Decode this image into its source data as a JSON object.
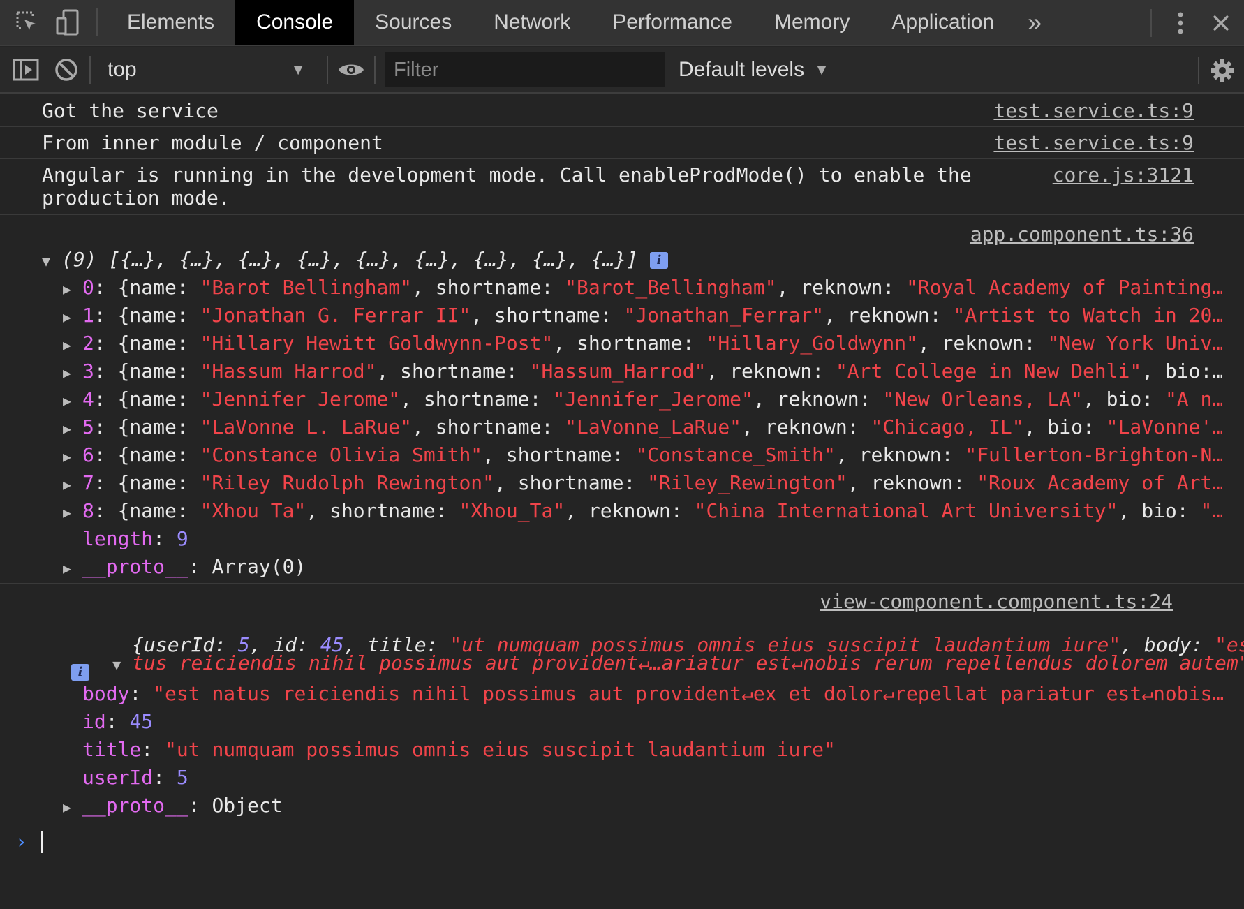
{
  "tabs": [
    {
      "label": "Elements"
    },
    {
      "label": "Console"
    },
    {
      "label": "Sources"
    },
    {
      "label": "Network"
    },
    {
      "label": "Performance"
    },
    {
      "label": "Memory"
    },
    {
      "label": "Application"
    }
  ],
  "tabbar": {
    "more": "»"
  },
  "toolbar": {
    "context": "top",
    "filter_placeholder": "Filter",
    "levels": "Default levels"
  },
  "messages": [
    {
      "text": "Got the service",
      "source": "test.service.ts:9"
    },
    {
      "text": "From inner module / component",
      "source": "test.service.ts:9"
    },
    {
      "text_line1": "Angular is running in the development mode. Call enableProdMode() to enable the",
      "text_line2": "production mode.",
      "source": "core.js:3121"
    }
  ],
  "array_log": {
    "source": "app.component.ts:36",
    "summary": "(9) [{…}, {…}, {…}, {…}, {…}, {…}, {…}, {…}, {…}]",
    "items": [
      {
        "index": "0",
        "name": "\"Barot Bellingham\"",
        "shortname": "\"Barot_Bellingham\"",
        "tail_key": "reknown",
        "tail_val": "\"Royal Academy of Painting…"
      },
      {
        "index": "1",
        "name": "\"Jonathan G. Ferrar II\"",
        "shortname": "\"Jonathan_Ferrar\"",
        "tail_key": "reknown",
        "tail_val": "\"Artist to Watch in 20…"
      },
      {
        "index": "2",
        "name": "\"Hillary Hewitt Goldwynn-Post\"",
        "shortname": "\"Hillary_Goldwynn\"",
        "tail_key": "reknown",
        "tail_val": "\"New York Univ…"
      },
      {
        "index": "3",
        "name": "\"Hassum Harrod\"",
        "shortname": "\"Hassum_Harrod\"",
        "tail_key": "reknown",
        "tail_val": "\"Art College in New Dehli\"",
        "extra": ", bio:…"
      },
      {
        "index": "4",
        "name": "\"Jennifer Jerome\"",
        "shortname": "\"Jennifer_Jerome\"",
        "tail_key": "reknown",
        "tail_val": "\"New Orleans, LA\"",
        "extra": ", bio: ",
        "extra_val": "\"A n…"
      },
      {
        "index": "5",
        "name": "\"LaVonne L. LaRue\"",
        "shortname": "\"LaVonne_LaRue\"",
        "tail_key": "reknown",
        "tail_val": "\"Chicago, IL\"",
        "extra": ", bio: ",
        "extra_val": "\"LaVonne'…"
      },
      {
        "index": "6",
        "name": "\"Constance Olivia Smith\"",
        "shortname": "\"Constance_Smith\"",
        "tail_key": "reknown",
        "tail_val": "\"Fullerton-Brighton-N…"
      },
      {
        "index": "7",
        "name": "\"Riley Rudolph Rewington\"",
        "shortname": "\"Riley_Rewington\"",
        "tail_key": "reknown",
        "tail_val": "\"Roux Academy of Art…"
      },
      {
        "index": "8",
        "name": "\"Xhou Ta\"",
        "shortname": "\"Xhou_Ta\"",
        "tail_key": "reknown",
        "tail_val": "\"China International Art University\"",
        "extra": ", bio: ",
        "extra_val": "\"…"
      }
    ],
    "length_key": "length",
    "length_val": "9",
    "proto_key": "__proto__",
    "proto_val": "Array(0)"
  },
  "object_log": {
    "source": "view-component.component.ts:24",
    "line1_prefix": "{userId: ",
    "line1_userId": "5",
    "line1_mid": ", id: ",
    "line1_id": "45",
    "line1_title_key": ", title: ",
    "line1_title": "\"ut numquam possimus omnis eius suscipit laudantium iure\"",
    "line1_body_key": ", body: ",
    "line1_body": "\"est na",
    "line2_body": "tus reiciendis nihil possimus aut provident↵…ariatur est↵nobis rerum repellendus dolorem autem\"",
    "line2_end": "}",
    "props": [
      {
        "key": "body",
        "val": "\"est natus reiciendis nihil possimus aut provident↵ex et dolor↵repellat pariatur est↵nobis…"
      },
      {
        "key": "id",
        "val": "45"
      },
      {
        "key": "title",
        "val": "\"ut numquam possimus omnis eius suscipit laudantium iure\""
      },
      {
        "key": "userId",
        "val": "5"
      }
    ],
    "proto_key": "__proto__",
    "proto_val": "Object"
  },
  "prompt": "›"
}
